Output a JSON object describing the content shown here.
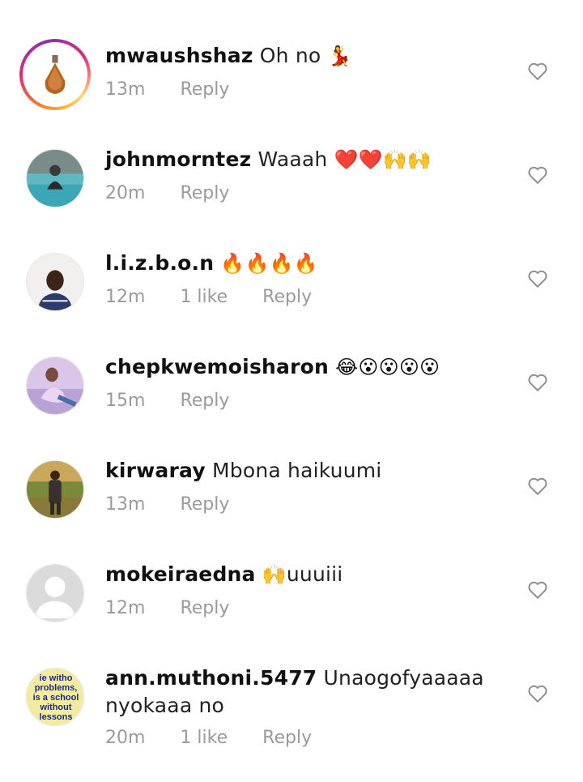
{
  "comments": [
    {
      "username": "mwaushshaz",
      "text": "Oh no",
      "emoji": "💃",
      "time": "13m",
      "likes": "",
      "reply": "Reply"
    },
    {
      "username": "johnmorntez",
      "text": "Waaah",
      "emoji": "❤️❤️🙌🙌",
      "time": "20m",
      "likes": "",
      "reply": "Reply"
    },
    {
      "username": "l.i.z.b.o.n",
      "text": "",
      "emoji": "🔥🔥🔥🔥",
      "time": "12m",
      "likes": "1 like",
      "reply": "Reply"
    },
    {
      "username": "chepkwemoisharon",
      "text": "",
      "emoji": "😂😮😮😮😮",
      "time": "15m",
      "likes": "",
      "reply": "Reply"
    },
    {
      "username": "kirwaray",
      "text": "Mbona haikuumi",
      "emoji": "",
      "time": "13m",
      "likes": "",
      "reply": "Reply"
    },
    {
      "username": "mokeiraedna",
      "text": "uuuiii",
      "emoji": "🙌",
      "time": "12m",
      "likes": "",
      "reply": "Reply"
    },
    {
      "username": "ann.muthoni.5477",
      "text": "Unaogofyaaaaa nyokaaa no",
      "emoji": "",
      "time": "20m",
      "likes": "1 like",
      "reply": "Reply"
    }
  ],
  "avatar_text": {
    "ann": [
      "ie witho",
      "problems,",
      "is a school",
      "without",
      "lessons"
    ]
  },
  "colors": {
    "meta": "#9a9a9a",
    "story_ring_start": "#f58529",
    "story_ring_end": "#dd2a7b"
  }
}
